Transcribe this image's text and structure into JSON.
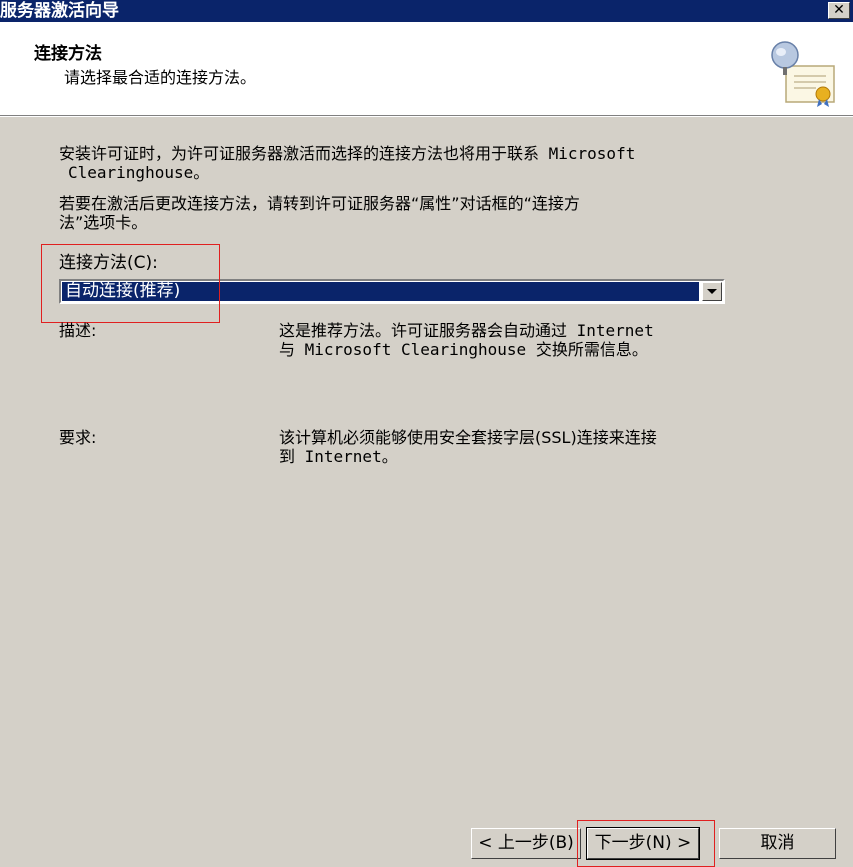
{
  "window": {
    "title": "服务器激活向导",
    "close_label": "✕"
  },
  "header": {
    "title": "连接方法",
    "subtitle": "请选择最合适的连接方法。",
    "icon": "certificate-globe-icon"
  },
  "body": {
    "intro_line1": "安装许可证时，为许可证服务器激活而选择的连接方法也将用于联系 Microsoft",
    "intro_line2": "Clearinghouse。",
    "change_line1": "若要在激活后更改连接方法，请转到许可证服务器“属性”对话框的“连接方",
    "change_line2": "法”选项卡。",
    "method_label": "连接方法(C):",
    "method_selected": "自动连接(推荐)",
    "desc_label": "描述:",
    "desc_line1": "这是推荐方法。许可证服务器会自动通过 Internet",
    "desc_line2": "与 Microsoft Clearinghouse 交换所需信息。",
    "req_label": "要求:",
    "req_line1": "该计算机必须能够使用安全套接字层(SSL)连接来连接",
    "req_line2": "到 Internet。"
  },
  "buttons": {
    "back": "< 上一步(B)",
    "next": "下一步(N) >",
    "cancel": "取消"
  },
  "colors": {
    "title_bar": "#0a246a",
    "highlight": "#0a246a",
    "annotation": "#e02020"
  }
}
